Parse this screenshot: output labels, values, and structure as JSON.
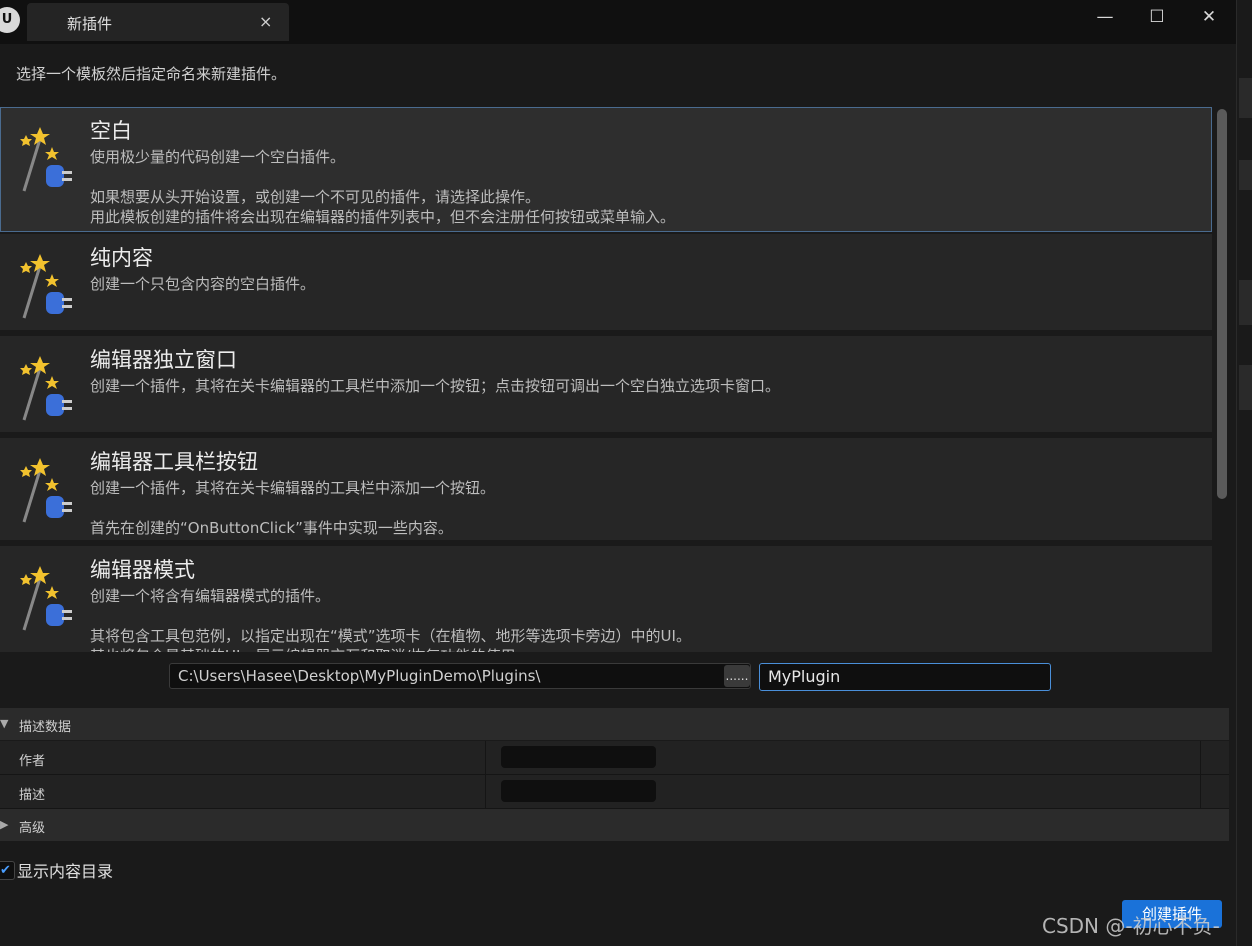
{
  "window": {
    "tab_title": "新插件",
    "close_tab": "×",
    "minimize": "—",
    "maximize": "☐",
    "close": "✕"
  },
  "intro_text": "选择一个模板然后指定命名来新建插件。",
  "templates": [
    {
      "name": "空白",
      "description": "使用极少量的代码创建一个空白插件。\n\n如果想要从头开始设置，或创建一个不可见的插件，请选择此操作。\n用此模板创建的插件将会出现在编辑器的插件列表中，但不会注册任何按钮或菜单输入。"
    },
    {
      "name": "纯内容",
      "description": "创建一个只包含内容的空白插件。"
    },
    {
      "name": "编辑器独立窗口",
      "description": "创建一个插件，其将在关卡编辑器的工具栏中添加一个按钮；点击按钮可调出一个空白独立选项卡窗口。"
    },
    {
      "name": "编辑器工具栏按钮",
      "description": "创建一个插件，其将在关卡编辑器的工具栏中添加一个按钮。\n\n首先在创建的“OnButtonClick”事件中实现一些内容。"
    },
    {
      "name": "编辑器模式",
      "description": "创建一个将含有编辑器模式的插件。\n\n其将包含工具包范例，以指定出现在“模式”选项卡（在植物、地形等选项卡旁边）中的UI。\n其也将包含最基础的UI，展示编辑器交互和取消/恢复功能的使用。"
    }
  ],
  "path_value": "C:\\Users\\Hasee\\Desktop\\MyPluginDemo\\Plugins\\",
  "browse_label": "......",
  "plugin_name": "MyPlugin",
  "descriptor": {
    "header": "描述数据",
    "author_label": "作者",
    "desc_label": "描述"
  },
  "advanced_header": "高级",
  "show_content_label": "显示内容目录",
  "create_button": "创建插件",
  "watermark": "CSDN @-初心不负-"
}
